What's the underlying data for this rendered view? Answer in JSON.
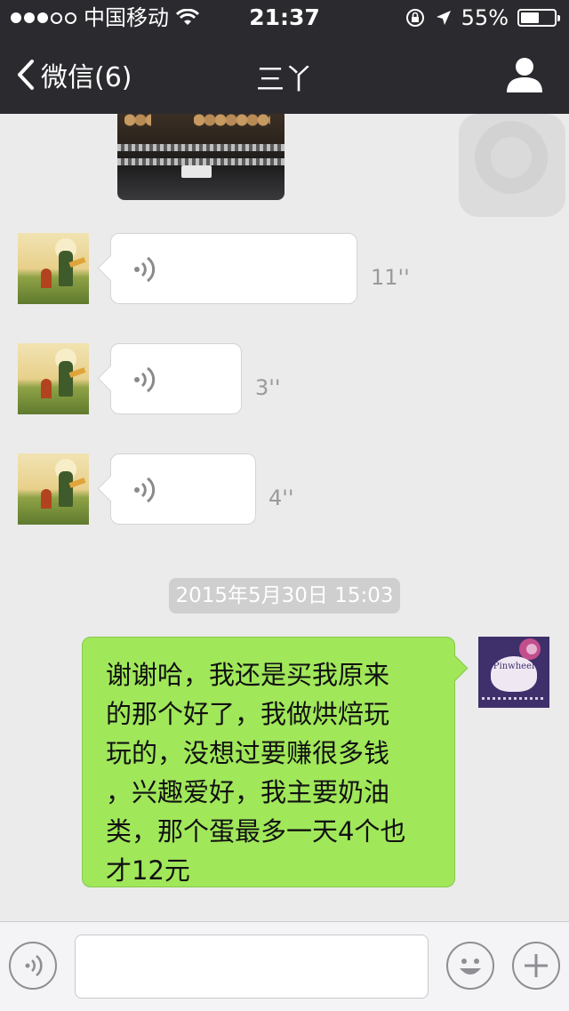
{
  "status_bar": {
    "carrier": "中国移动",
    "time": "21:37",
    "battery_percent": "55%",
    "battery_level": 0.55
  },
  "nav": {
    "back_label": "微信(6)",
    "title": "三丫"
  },
  "messages": {
    "voice": [
      {
        "duration": "11''"
      },
      {
        "duration": "3''"
      },
      {
        "duration": "4''"
      }
    ],
    "timestamp": "2015年5月30日 15:03",
    "text_lines": [
      "谢谢哈，我还是买我原来",
      "的那个好了，我做烘焙玩",
      "玩的，没想过要赚很多钱",
      "，兴趣爱好，我主要奶油",
      "类，那个蛋最多一天4个也",
      "才12元"
    ],
    "my_avatar_text": "Pinwheel"
  },
  "input_bar": {
    "voice_icon": "voice-icon",
    "emoji_icon": "smiley-icon",
    "add_icon": "plus-icon",
    "input_value": ""
  },
  "colors": {
    "nav_bg": "#2a2a2f",
    "chat_bg": "#ebebeb",
    "my_bubble": "#a0e75a"
  }
}
